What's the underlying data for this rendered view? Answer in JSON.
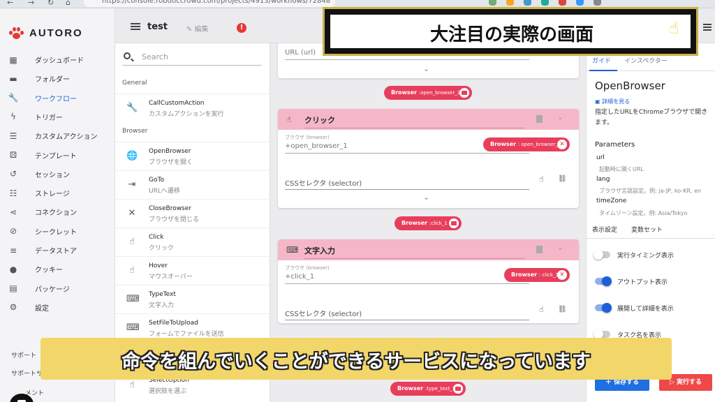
{
  "browser": {
    "url": "https://console.roboticcrowd.com/projects/4913/workflows/72848"
  },
  "leftnav": {
    "logo": "AUTORO",
    "items": [
      {
        "icon": "dashboard-icon",
        "label": "ダッシュボード"
      },
      {
        "icon": "folder-icon",
        "label": "フォルダー"
      },
      {
        "icon": "wrench-icon",
        "label": "ワークフロー"
      },
      {
        "icon": "bolt-icon",
        "label": "トリガー"
      },
      {
        "icon": "custom-action-icon",
        "label": "カスタムアクション"
      },
      {
        "icon": "template-icon",
        "label": "テンプレート"
      },
      {
        "icon": "history-icon",
        "label": "セッション"
      },
      {
        "icon": "storage-icon",
        "label": "ストレージ"
      },
      {
        "icon": "share-icon",
        "label": "コネクション"
      },
      {
        "icon": "eye-off-icon",
        "label": "シークレット"
      },
      {
        "icon": "list-icon",
        "label": "データストア"
      },
      {
        "icon": "cookie-icon",
        "label": "クッキー"
      },
      {
        "icon": "store-icon",
        "label": "パッケージ"
      },
      {
        "icon": "gear-icon",
        "label": "設定"
      }
    ],
    "active_index": 2,
    "support": "サポート",
    "support2": "サポートサ",
    "comment": "メント"
  },
  "header": {
    "title": "test",
    "edit_label": "編集",
    "alert": "!"
  },
  "commands": {
    "search_placeholder": "Search",
    "general_label": "General",
    "browser_label": "Browser",
    "general": [
      {
        "name": "CallCustomAction",
        "desc": "カスタムアクションを実行"
      }
    ],
    "browser": [
      {
        "name": "OpenBrowser",
        "desc": "ブラウザを開く"
      },
      {
        "name": "GoTo",
        "desc": "URLへ遷移"
      },
      {
        "name": "CloseBrowser",
        "desc": "ブラウザを閉じる"
      },
      {
        "name": "Click",
        "desc": "クリック"
      },
      {
        "name": "Hover",
        "desc": "マウスオーバー"
      },
      {
        "name": "TypeText",
        "desc": "文字入力"
      },
      {
        "name": "SetFileToUpload",
        "desc": "フォームでファイルを送信"
      },
      {
        "name": "",
        "desc": ""
      },
      {
        "name": "SelectOption",
        "desc": "選択肢を選ぶ"
      }
    ]
  },
  "canvas": {
    "url_field_label": "URL (url)",
    "chip1": {
      "type": "Browser",
      "id": ":open_browser_1"
    },
    "click_card": {
      "title": "クリック",
      "browser_label": "ブラウザ (browser)",
      "browser_value": "+open_browser_1",
      "chip_type": "Browser",
      "chip_id": ": open_browser_1",
      "css_label": "CSSセレクタ (selector)"
    },
    "chip2": {
      "type": "Browser",
      "id": ":click_1"
    },
    "type_card": {
      "title": "文字入力",
      "browser_label": "ブラウザ (browser)",
      "browser_value": "+click_1",
      "chip_type": "Browser",
      "chip_id": ": click_1",
      "css_label": "CSSセレクタ (selector)"
    },
    "chip3": {
      "type": "Browser",
      "id": ":type_text_1"
    }
  },
  "rpanel": {
    "tabs": [
      "ガイド",
      "インスペクター"
    ],
    "op_title": "OpenBrowser",
    "detail_link": "詳細を見る",
    "description": "指定したURLをChromeブラウザで開きます。",
    "params_heading": "Parameters",
    "params": [
      {
        "key": "url",
        "desc": "起動時に開くURL"
      },
      {
        "key": "lang",
        "desc": "ブラウザ言語設定。例: ja-JP, ko-KR, en"
      },
      {
        "key": "timeZone",
        "desc": "タイムゾーン設定。例: Asia/Tokyo"
      }
    ],
    "tabs2": [
      "表示設定",
      "変数セット"
    ],
    "toggles": [
      {
        "label": "実行タイミング表示",
        "on": false
      },
      {
        "label": "アウトプット表示",
        "on": true
      },
      {
        "label": "展開して詳細を表示",
        "on": true
      },
      {
        "label": "タスク名を表示",
        "on": false
      }
    ],
    "save": "保存する",
    "run": "実行する"
  },
  "overlay": {
    "title": "大注目の実際の画面",
    "caption": "命令を組んでいくことができるサービスになっています"
  },
  "colors": {
    "accent_blue": "#1e5fd9",
    "card_header_pink": "#f5b7c8",
    "chip_red": "#e83e5c",
    "run_red": "#f04848",
    "caption_yellow": "#f2d66a"
  }
}
